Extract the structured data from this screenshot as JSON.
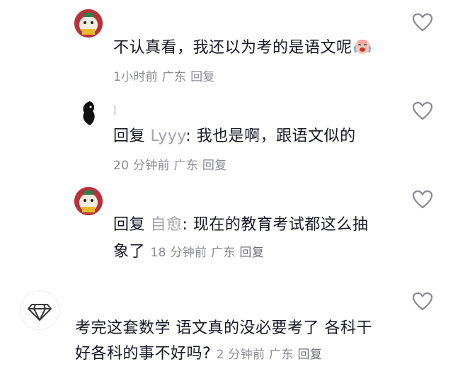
{
  "comments": [
    {
      "username": "",
      "text": "不认真看，我还以为考的是语文呢",
      "emoji": "crying-laughing-face",
      "time": "1小时前",
      "location": "广东",
      "reply_label": "回复"
    },
    {
      "username": "|",
      "reply_prefix": "回复",
      "reply_target": "Lyyy",
      "text": ": 我也是啊，跟语文似的",
      "time": "20 分钟前",
      "location": "广东",
      "reply_label": "回复"
    },
    {
      "username": "",
      "reply_prefix": "回复",
      "reply_target": "自愈",
      "text_line1": ": 现在的教育考试都这么抽",
      "text_line2": "象了",
      "time": "18 分钟前",
      "location": "广东",
      "reply_label": "回复"
    },
    {
      "username": "",
      "text_line1": "考完这套数学 语文真的没必要考了 各科干",
      "text_line2": "好各科的事不好吗?",
      "time": "2 分钟前",
      "location": "广东",
      "reply_label": "回复"
    }
  ],
  "colors": {
    "text": "#161823",
    "muted": "#8a8b91",
    "reply_target": "#a2a3a8",
    "heart_stroke": "#8a8b91"
  }
}
